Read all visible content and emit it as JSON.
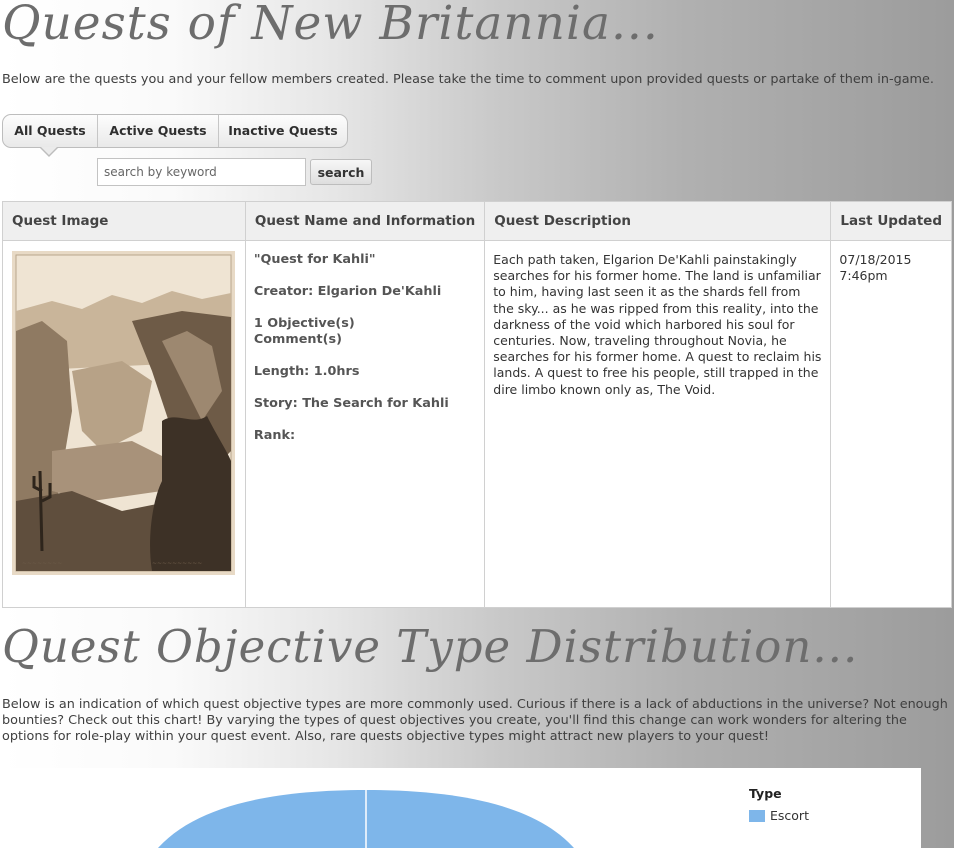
{
  "page": {
    "title": "Quests of New Britannia...",
    "intro": "Below are the quests you and your fellow members created. Please take the time to comment upon provided quests or partake of them in-game."
  },
  "tabs": [
    {
      "label": "All Quests",
      "active": true
    },
    {
      "label": "Active Quests",
      "active": false
    },
    {
      "label": "Inactive Quests",
      "active": false
    }
  ],
  "search": {
    "placeholder": "search by keyword",
    "value": "",
    "button_label": "search"
  },
  "table": {
    "headers": [
      "Quest Image",
      "Quest Name and Information",
      "Quest Description",
      "Last Updated"
    ],
    "rows": [
      {
        "name": "\"Quest for Kahli\"",
        "creator": "Creator: Elgarion De'Kahli",
        "objectives": "1 Objective(s)",
        "comments": "Comment(s)",
        "length": "Length: 1.0hrs",
        "story": "Story: The Search for Kahli",
        "rank": "Rank:",
        "description": "Each path taken, Elgarion De'Kahli painstakingly searches for his former home. The land is unfamiliar to him, having last seen it as the shards fell from the sky... as he was ripped from this reality, into the darkness of the void which harbored his soul for centuries. Now, traveling throughout Novia, he searches for his former home. A quest to reclaim his lands. A quest to free his people, still trapped in the dire limbo known only as, The Void.",
        "updated_date": "07/18/2015",
        "updated_time": "7:46pm"
      }
    ]
  },
  "distribution": {
    "title": "Quest Objective Type Distribution...",
    "intro": "Below is an indication of which quest objective types are more commonly used. Curious if there is a lack of abductions in the universe? Not enough bounties? Check out this chart! By varying the types of quest objectives you create, you'll find this change can work wonders for altering the options for role-play within your quest event. Also, rare quests objective types might attract new players to your quest!",
    "legend_title": "Type",
    "legend_items": [
      {
        "label": "Escort",
        "color": "#7eb6ea"
      }
    ]
  },
  "colors": {
    "pie_fill": "#7eb6ea",
    "title_color": "#6d6d6d"
  }
}
